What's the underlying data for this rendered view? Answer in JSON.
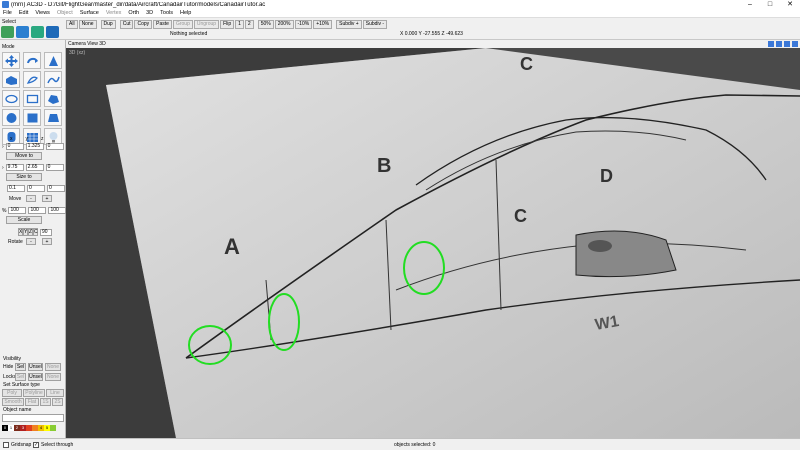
{
  "window": {
    "title": "(mrn) AC3D - D:/Git/FlightGear/master_dir/data/Aircraft/CanadairTutor/models/CanadairTutor.ac",
    "controls": [
      "–",
      "□",
      "✕"
    ]
  },
  "menu": [
    "File",
    "Edit",
    "Views",
    "Object",
    "Surface",
    "Vertex",
    "Orth",
    "3D",
    "Tools",
    "Help"
  ],
  "menu_dim": [
    "Object",
    "Vertex"
  ],
  "toolbar": {
    "select_label": "Select",
    "buttons": [
      "All",
      "None",
      "Dup",
      "Cut",
      "Copy",
      "Paste",
      "Group",
      "Ungroup",
      "Flip",
      "1",
      "2",
      "50%",
      "200%",
      "-10%",
      "+10%",
      "Subdiv +",
      "Subdiv -"
    ],
    "status": "Nothing selected",
    "coords": "X 0.000 Y -27.555 Z -49.623"
  },
  "left_panel": {
    "mode_label": "Mode",
    "xyz_header": [
      "x",
      "y",
      "z"
    ],
    "pos_values": [
      "0",
      "1.325",
      "0"
    ],
    "move_to": "Move to",
    "size_values": [
      "9.75",
      "2.65",
      "0"
    ],
    "size_to": "Size to",
    "move_values": [
      "0.1",
      "0",
      "0"
    ],
    "move": "Move",
    "minus": "-",
    "plus": "+",
    "pct": "%",
    "scale_values": [
      "100",
      "100",
      "100"
    ],
    "scale": "Scale",
    "axis_buttons": [
      "X",
      "Y",
      "Z",
      "C"
    ],
    "rotate_value": "90",
    "rotate": "Rotate",
    "visibility_label": "Visibility",
    "hide": "Hide",
    "locks": "Locks",
    "sel": "Sel",
    "unsel": "Unsel",
    "none": "None",
    "surface_type_label": "Set Surface type",
    "surface_buttons": [
      "Poly",
      "Polyline",
      "Line",
      "Smooth",
      "Flat",
      "1S",
      "2S"
    ],
    "object_name_label": "Object name",
    "palette": [
      {
        "label": "0",
        "color": "#000000"
      },
      {
        "label": "1",
        "color": "#ffffff"
      },
      {
        "label": "2",
        "color": "#7a2a1a"
      },
      {
        "label": "3",
        "color": "#b02020"
      },
      {
        "label": "",
        "color": "#e04020"
      },
      {
        "label": "",
        "color": "#f08020"
      },
      {
        "label": "4",
        "color": "#f0c000"
      },
      {
        "label": "5",
        "color": "#ffff00"
      },
      {
        "label": "",
        "color": "#88cc33"
      }
    ]
  },
  "viewport": {
    "header": "Camera  View  3D",
    "label": "3D (xz)",
    "blueprint_letters": [
      "A",
      "B",
      "C",
      "C",
      "D",
      "W1"
    ]
  },
  "statusbar": {
    "gridsnap": "Gridsnap",
    "select_through": "Select through",
    "objects_selected": "objects selected: 0"
  },
  "colors": {
    "highlight": "#22dd22",
    "viewport_bg": "#3c3c3c"
  }
}
